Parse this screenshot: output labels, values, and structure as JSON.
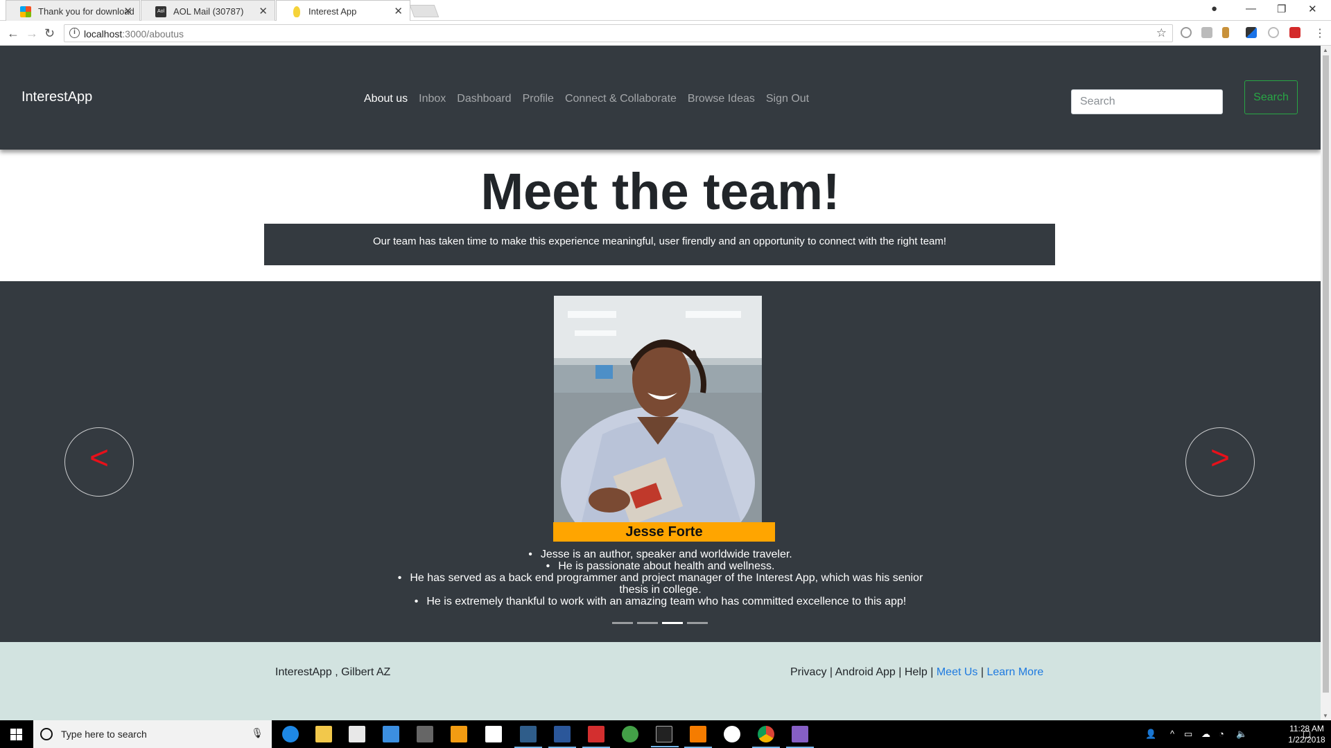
{
  "browser": {
    "tabs": [
      {
        "title": "Thank you for download",
        "favicon_color": "#f25022",
        "active": false
      },
      {
        "title": "AOL Mail (30787)",
        "favicon_color": "#333333",
        "active": false
      },
      {
        "title": "Interest App",
        "favicon_color": "#f5d33a",
        "active": true
      }
    ],
    "url_host": "localhost",
    "url_path": ":3000/aboutus"
  },
  "nav": {
    "brand": "InterestApp",
    "links": [
      "About us",
      "Inbox",
      "Dashboard",
      "Profile",
      "Connect & Collaborate",
      "Browse Ideas",
      "Sign Out"
    ],
    "search_placeholder": "Search",
    "search_button": "Search"
  },
  "hero": {
    "title": "Meet the team!",
    "intro": "Our team has taken time to make this experience meaningful, user firendly and an opportunity to connect with the right team!"
  },
  "carousel": {
    "prev_label": "<",
    "next_label": ">",
    "member": {
      "name": "Jesse Forte",
      "bio": [
        "Jesse is an author, speaker and worldwide traveler.",
        "He is passionate about health and wellness.",
        "He has served as a back end programmer and project manager of the Interest App, which was his senior thesis in college.",
        "He is extremely thankful to work with an amazing team who has committed excellence to this app!"
      ]
    },
    "indicator_count": 4,
    "active_index": 2,
    "accent_color": "#ffa500"
  },
  "footer": {
    "left": "InterestApp , Gilbert AZ",
    "links": [
      "Privacy",
      "Android App",
      "Help",
      "Meet Us",
      "Learn More"
    ],
    "separator": "|"
  },
  "taskbar": {
    "search_placeholder": "Type here to search",
    "time": "11:28 AM",
    "date": "1/22/2018"
  }
}
